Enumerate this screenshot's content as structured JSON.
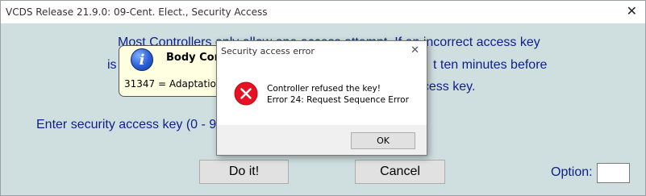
{
  "window": {
    "title": "VCDS Release 21.9.0: 09-Cent. Elect.,  Security Access",
    "close_glyph": "✕"
  },
  "main": {
    "message_lines": [
      "Most Controllers only allow one access attempt.  If an incorrect access key",
      "is",
      "t ten minutes before",
      "access key."
    ],
    "prompt": "Enter security access key (0 - 99",
    "doit_label": "Do it!",
    "cancel_label": "Cancel",
    "option_label": "Option:",
    "option_value": ""
  },
  "tooltip": {
    "icon": "info-icon",
    "title": "Body Cont",
    "text": "31347 = Adaptation"
  },
  "dialog": {
    "title": "Security access error",
    "close_glyph": "✕",
    "icon": "error-icon",
    "line1": "Controller refused the key!",
    "line2": "Error 24: Request Sequence Error",
    "ok_label": "OK"
  },
  "colors": {
    "window_bg": "#cfdfe0",
    "text_blue": "#0d1f8a",
    "tooltip_bg": "#ffffe1",
    "error_red": "#e81123"
  }
}
